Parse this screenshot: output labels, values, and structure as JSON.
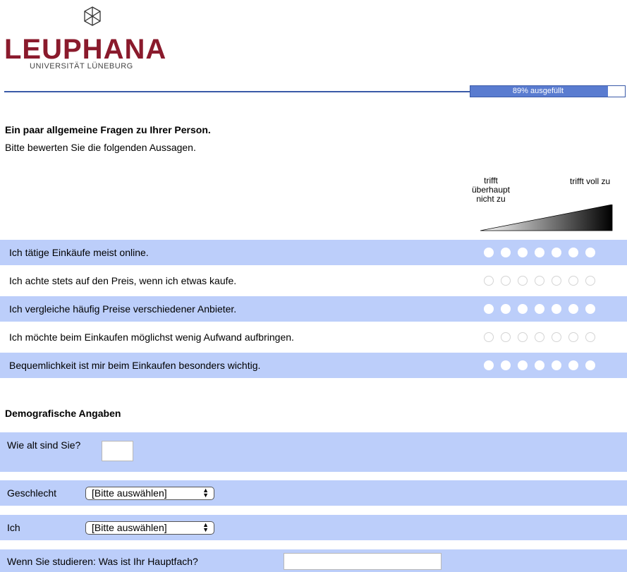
{
  "logo": {
    "name": "LEUPHANA",
    "subtitle": "UNIVERSITÄT LÜNEBURG"
  },
  "progress": {
    "label": "89% ausgefüllt",
    "percent": 89
  },
  "section1": {
    "title": "Ein paar allgemeine Fragen zu Ihrer Person.",
    "instruction": "Bitte bewerten Sie die folgenden Aussagen.",
    "scale_low": "trifft überhaupt nicht zu",
    "scale_high": "trifft voll zu",
    "items": [
      {
        "text": "Ich tätige Einkäufe meist online."
      },
      {
        "text": "Ich achte stets auf den Preis, wenn ich etwas kaufe."
      },
      {
        "text": "Ich vergleiche häufig Preise verschiedener Anbieter."
      },
      {
        "text": "Ich möchte beim Einkaufen möglichst wenig Aufwand aufbringen."
      },
      {
        "text": "Bequemlichkeit ist mir beim Einkaufen besonders wichtig."
      }
    ]
  },
  "section2": {
    "title": "Demografische Angaben",
    "age_label": "Wie alt sind Sie?",
    "age_value": "",
    "gender_label": "Geschlecht",
    "gender_value": "[Bitte auswählen]",
    "status_label": "Ich",
    "status_value": "[Bitte auswählen]",
    "major_label": "Wenn Sie studieren: Was ist Ihr Hauptfach?",
    "major_value": ""
  },
  "colors": {
    "brand": "#8a1a2c",
    "accent": "#3a5aa8",
    "row_shade": "#bccefa"
  }
}
